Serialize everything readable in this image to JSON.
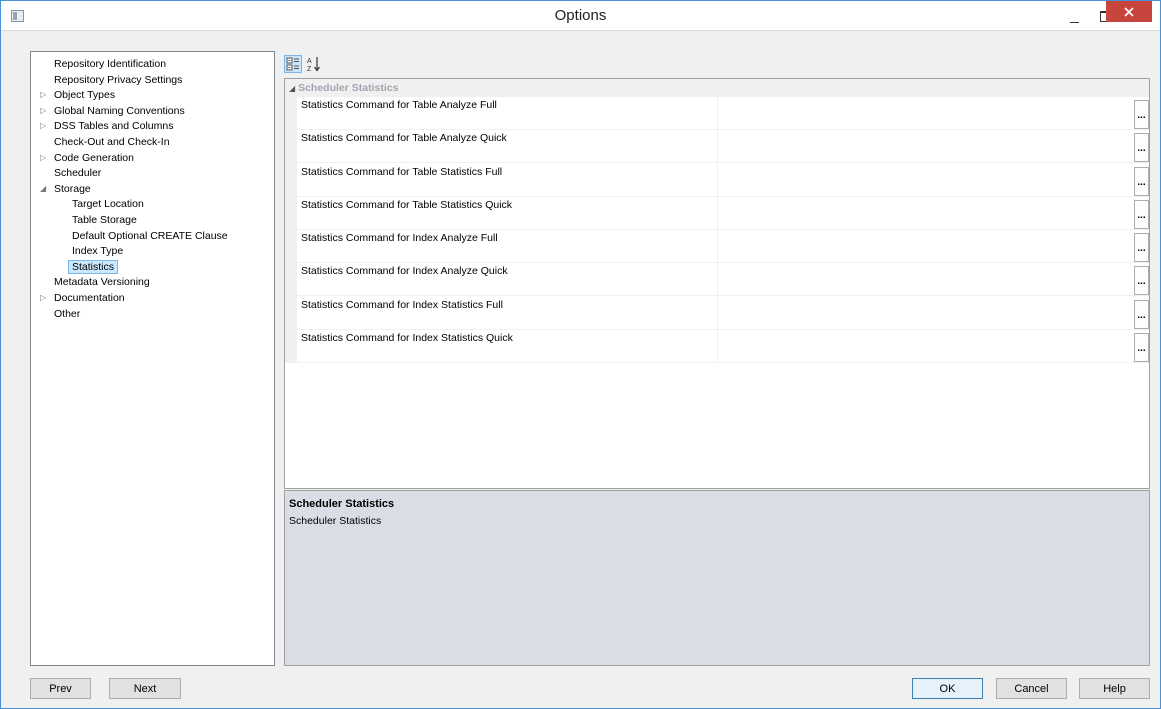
{
  "window": {
    "title": "Options"
  },
  "tree": {
    "items": [
      {
        "label": "Repository Identification",
        "expandable": false,
        "expanded": false,
        "level": 0
      },
      {
        "label": "Repository Privacy Settings",
        "expandable": false,
        "expanded": false,
        "level": 0
      },
      {
        "label": "Object Types",
        "expandable": true,
        "expanded": false,
        "level": 0
      },
      {
        "label": "Global Naming Conventions",
        "expandable": true,
        "expanded": false,
        "level": 0
      },
      {
        "label": "DSS Tables and Columns",
        "expandable": true,
        "expanded": false,
        "level": 0
      },
      {
        "label": "Check-Out and Check-In",
        "expandable": false,
        "expanded": false,
        "level": 0
      },
      {
        "label": "Code Generation",
        "expandable": true,
        "expanded": false,
        "level": 0
      },
      {
        "label": "Scheduler",
        "expandable": false,
        "expanded": false,
        "level": 0
      },
      {
        "label": "Storage",
        "expandable": true,
        "expanded": true,
        "level": 0
      },
      {
        "label": "Target Location",
        "expandable": false,
        "expanded": false,
        "level": 1
      },
      {
        "label": "Table Storage",
        "expandable": false,
        "expanded": false,
        "level": 1
      },
      {
        "label": "Default Optional CREATE Clause",
        "expandable": false,
        "expanded": false,
        "level": 1
      },
      {
        "label": "Index Type",
        "expandable": false,
        "expanded": false,
        "level": 1
      },
      {
        "label": "Statistics",
        "expandable": false,
        "expanded": false,
        "level": 1,
        "selected": true
      },
      {
        "label": "Metadata Versioning",
        "expandable": false,
        "expanded": false,
        "level": 0
      },
      {
        "label": "Documentation",
        "expandable": true,
        "expanded": false,
        "level": 0
      },
      {
        "label": "Other",
        "expandable": false,
        "expanded": false,
        "level": 0
      }
    ]
  },
  "toolbar": {
    "categorized_icon": "categorized-view-icon",
    "sort_icon": "sort-alphabetical-icon"
  },
  "grid": {
    "category": "Scheduler Statistics",
    "properties": [
      {
        "name": "Statistics Command for Table Analyze Full",
        "value": ""
      },
      {
        "name": "Statistics Command for Table Analyze Quick",
        "value": ""
      },
      {
        "name": "Statistics Command for Table Statistics Full",
        "value": ""
      },
      {
        "name": "Statistics Command for Table Statistics Quick",
        "value": ""
      },
      {
        "name": "Statistics Command for Index Analyze Full",
        "value": ""
      },
      {
        "name": "Statistics Command for Index Analyze Quick",
        "value": ""
      },
      {
        "name": "Statistics Command for Index Statistics Full",
        "value": ""
      },
      {
        "name": "Statistics Command for Index Statistics Quick",
        "value": ""
      }
    ],
    "ellipsis_label": "..."
  },
  "description": {
    "title": "Scheduler Statistics",
    "text": "Scheduler Statistics"
  },
  "buttons": {
    "prev": "Prev",
    "next": "Next",
    "ok": "OK",
    "cancel": "Cancel",
    "help": "Help"
  },
  "colors": {
    "selection": "#cce8ff",
    "close_button": "#c7453c",
    "description_bg": "#dadde6"
  }
}
